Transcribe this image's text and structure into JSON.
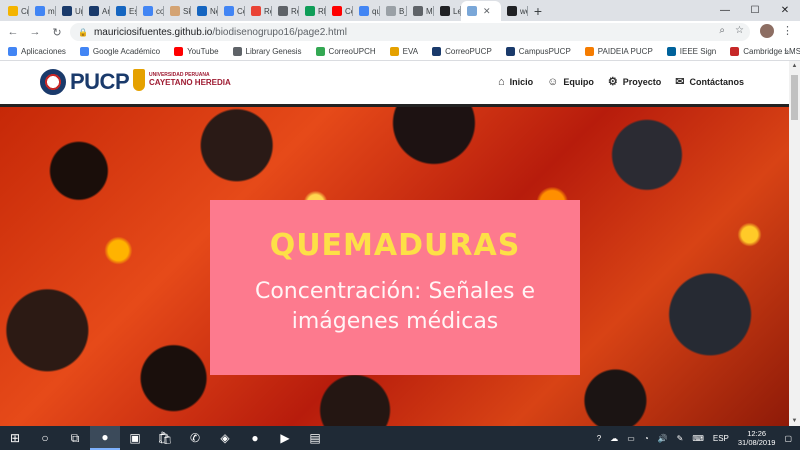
{
  "browser": {
    "tabs": [
      {
        "label": "Cre",
        "color": "#f4b400"
      },
      {
        "label": "me",
        "color": "#4285f4"
      },
      {
        "label": "Un",
        "color": "#1a3a6b"
      },
      {
        "label": "An",
        "color": "#1a3a6b"
      },
      {
        "label": "Esc",
        "color": "#1565c0"
      },
      {
        "label": "co",
        "color": "#4285f4"
      },
      {
        "label": "Ski",
        "color": "#d4a373"
      },
      {
        "label": "Ne",
        "color": "#1565c0"
      },
      {
        "label": "Co",
        "color": "#4285f4"
      },
      {
        "label": "Re",
        "color": "#ea4335"
      },
      {
        "label": "Re",
        "color": "#5f6368"
      },
      {
        "label": "RE",
        "color": "#0f9d58"
      },
      {
        "label": "Có",
        "color": "#ff0000"
      },
      {
        "label": "qu",
        "color": "#4285f4"
      },
      {
        "label": "B_I",
        "color": "#9aa0a6"
      },
      {
        "label": "Mi",
        "color": "#5f6368"
      },
      {
        "label": "Lec",
        "color": "#202124"
      },
      {
        "label": "",
        "color": "#7aa7d8"
      },
      {
        "label": "we",
        "color": "#202124"
      }
    ],
    "active_tab_label": "",
    "new_tab": "+",
    "window_controls": [
      "—",
      "☐",
      "✕"
    ],
    "url_domain": "mauriciosifuentes.github.io",
    "url_path": "/biodisenogrupo16/page2.html",
    "bookmarks": [
      {
        "label": "Aplicaciones",
        "color": "#4285f4"
      },
      {
        "label": "Google Académico",
        "color": "#4285f4"
      },
      {
        "label": "YouTube",
        "color": "#ff0000"
      },
      {
        "label": "Library Genesis",
        "color": "#5f6368"
      },
      {
        "label": "CorreoUPCH",
        "color": "#34a853"
      },
      {
        "label": "EVA",
        "color": "#e5a100"
      },
      {
        "label": "CorreoPUCP",
        "color": "#1a3a6b"
      },
      {
        "label": "CampusPUCP",
        "color": "#1a3a6b"
      },
      {
        "label": "PAIDEIA PUCP",
        "color": "#f57c00"
      },
      {
        "label": "IEEE Sign",
        "color": "#00629b"
      },
      {
        "label": "Cambridge LMS",
        "color": "#c62828"
      }
    ],
    "bookmarks_more": "»"
  },
  "site": {
    "logo_pucp": "PUCP",
    "logo_cayetano_small": "UNIVERSIDAD PERUANA",
    "logo_cayetano_big": "CAYETANO HEREDIA",
    "nav": [
      {
        "label": "Inicio",
        "icon": "⌂"
      },
      {
        "label": "Equipo",
        "icon": "☺"
      },
      {
        "label": "Proyecto",
        "icon": "⚙"
      },
      {
        "label": "Contáctanos",
        "icon": "✉"
      }
    ],
    "hero_title": "QUEMADURAS",
    "hero_subtitle": "Concentración: Señales e imágenes médicas",
    "colors": {
      "card": "#fd7a8e",
      "title": "#fde047"
    }
  },
  "taskbar": {
    "icons": [
      "⊞",
      "○",
      "⧉",
      "●",
      "▣",
      "🛍",
      "✆",
      "◈",
      "●",
      "▶",
      "▤"
    ],
    "tray_lang": "ESP",
    "time": "12:26",
    "date": "31/08/2019"
  }
}
